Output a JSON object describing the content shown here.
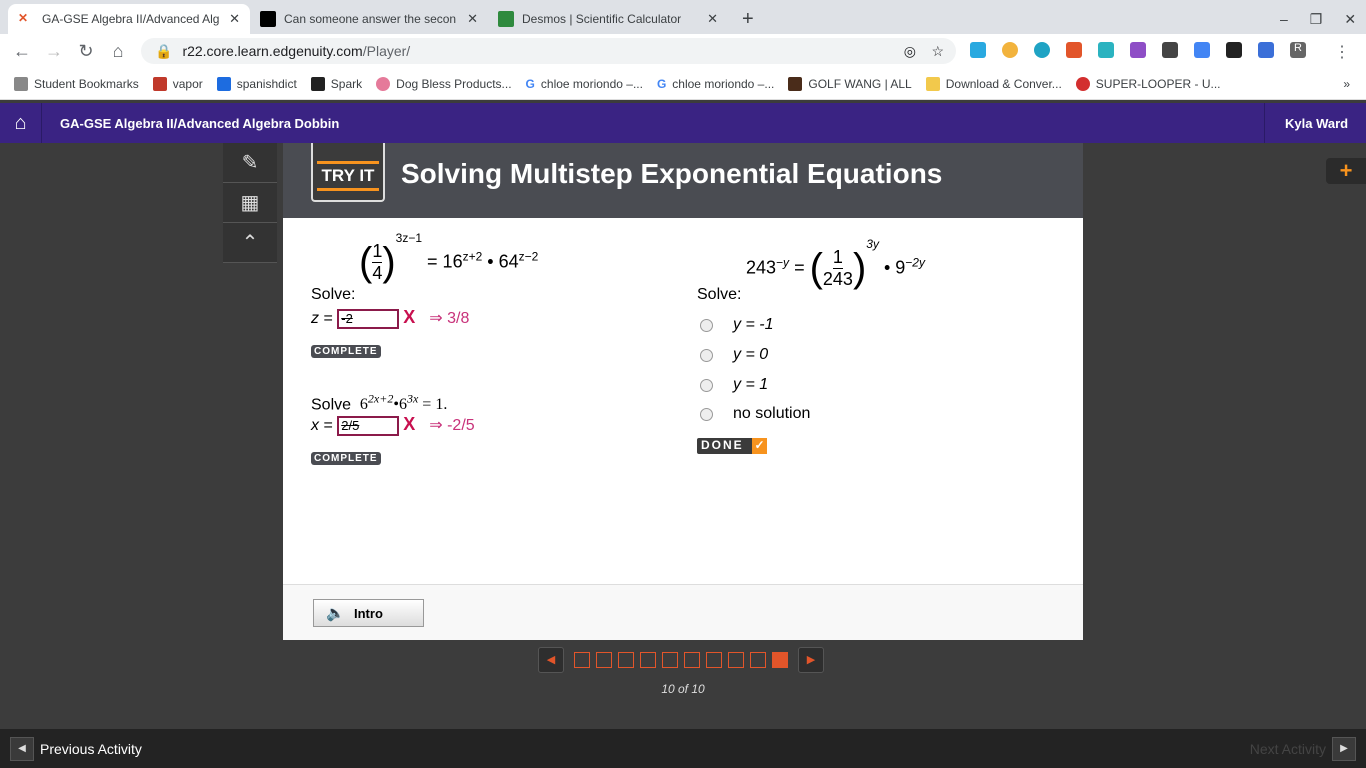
{
  "browser": {
    "tabs": [
      {
        "title": "GA-GSE Algebra II/Advanced Alg",
        "color": "#e2552a"
      },
      {
        "title": "Can someone answer the secon",
        "color": "#000"
      },
      {
        "title": "Desmos | Scientific Calculator",
        "color": "#2f8a3e"
      }
    ],
    "url_host": "r22.core.learn.edgenuity.com",
    "url_path": "/Player/",
    "bookmarks": [
      "Student Bookmarks",
      "vapor",
      "spanishdict",
      "Spark",
      "Dog Bless Products...",
      "chloe moriondo –...",
      "chloe moriondo –...",
      "GOLF WANG | ALL",
      "Download & Conver...",
      "SUPER-LOOPER - U..."
    ]
  },
  "header": {
    "course": "GA-GSE Algebra II/Advanced Algebra Dobbin",
    "user": "Kyla Ward"
  },
  "lesson": {
    "badge": "TRY IT",
    "title": "Solving Multistep Exponential Equations"
  },
  "q1": {
    "prompt": "Solve:",
    "var": "z",
    "answer": "-2",
    "correct": "⇒ 3/8",
    "status": "COMPLETE",
    "exp1": "3z−1",
    "rhs": "= 16",
    "exp2": "z+2",
    "mid": "• 64",
    "exp3": "z−2"
  },
  "q2": {
    "prompt": "Solve",
    "var": "x",
    "answer": "2/5",
    "correct": "⇒ -2/5",
    "status": "COMPLETE",
    "base": "6",
    "exp1": "2x+2",
    "exp2": "3x",
    "rhs": "= 1."
  },
  "q3": {
    "prompt": "Solve:",
    "lhs": "243",
    "lhs_exp": "−y",
    "exp": "3y",
    "base2": "9",
    "exp2": "−2y",
    "options": [
      "y = -1",
      "y = 0",
      "y = 1",
      "no solution"
    ],
    "done": "DONE"
  },
  "footer": {
    "intro": "Intro",
    "page_text": "10 of 10",
    "current_page": 10,
    "total_pages": 10,
    "prev": "Previous Activity",
    "next": "Next Activity"
  }
}
